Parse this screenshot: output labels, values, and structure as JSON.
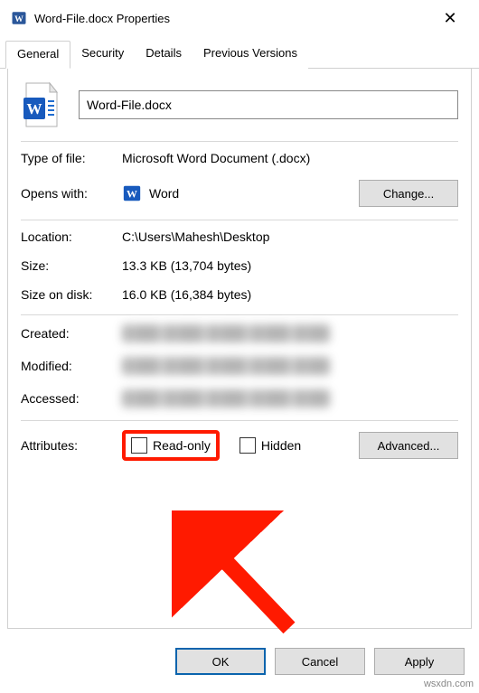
{
  "window": {
    "title": "Word-File.docx Properties",
    "close_glyph": "✕"
  },
  "tabs": {
    "general": "General",
    "security": "Security",
    "details": "Details",
    "previous_versions": "Previous Versions"
  },
  "file": {
    "name": "Word-File.docx"
  },
  "labels": {
    "type_of_file": "Type of file:",
    "opens_with": "Opens with:",
    "location": "Location:",
    "size": "Size:",
    "size_on_disk": "Size on disk:",
    "created": "Created:",
    "modified": "Modified:",
    "accessed": "Accessed:",
    "attributes": "Attributes:"
  },
  "values": {
    "type_of_file": "Microsoft Word Document (.docx)",
    "opens_with_app": "Word",
    "location": "C:\\Users\\Mahesh\\Desktop",
    "size": "13.3 KB (13,704 bytes)",
    "size_on_disk": "16.0 KB (16,384 bytes)"
  },
  "buttons": {
    "change": "Change...",
    "advanced": "Advanced...",
    "ok": "OK",
    "cancel": "Cancel",
    "apply": "Apply"
  },
  "attributes": {
    "read_only": "Read-only",
    "hidden": "Hidden"
  },
  "watermark": "wsxdn.com"
}
